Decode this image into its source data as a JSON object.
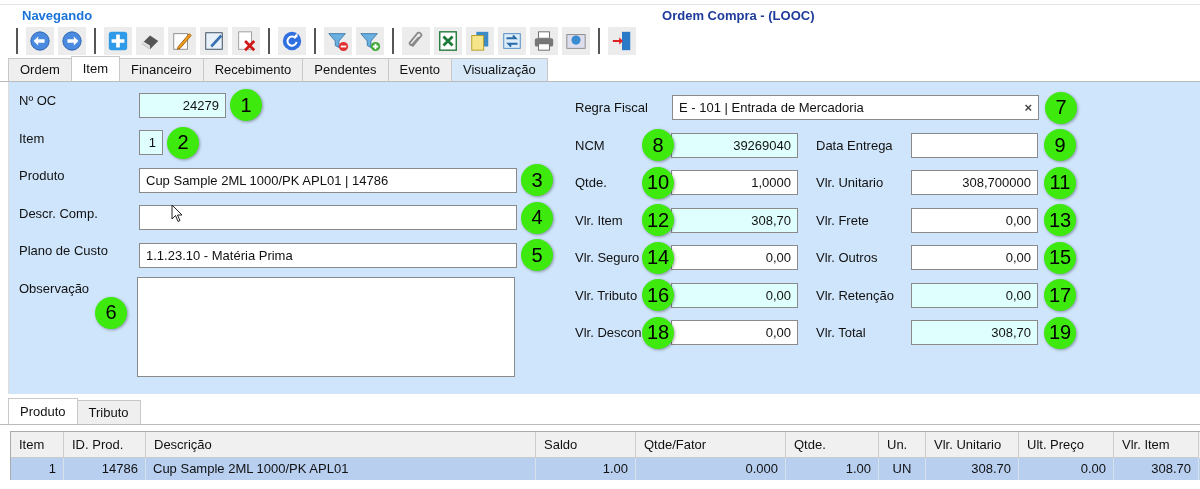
{
  "header": {
    "status": "Navegando",
    "title": "Ordem Compra - (LOOC)"
  },
  "tabs": [
    {
      "label": "Ordem",
      "selected": false,
      "hovered": false
    },
    {
      "label": "Item",
      "selected": true,
      "hovered": false
    },
    {
      "label": "Financeiro",
      "selected": false,
      "hovered": false
    },
    {
      "label": "Recebimento",
      "selected": false,
      "hovered": false
    },
    {
      "label": "Pendentes",
      "selected": false,
      "hovered": false
    },
    {
      "label": "Evento",
      "selected": false,
      "hovered": false
    },
    {
      "label": "Visualização",
      "selected": false,
      "hovered": true
    }
  ],
  "left_fields": [
    {
      "label": "Nº OC",
      "value": "24279",
      "readonly": true,
      "kind": "short",
      "marker": "1"
    },
    {
      "label": "Item",
      "value": "1",
      "readonly": true,
      "kind": "tiny",
      "marker": "2"
    },
    {
      "label": "Produto",
      "value": "Cup Sample 2ML 1000/PK APL01 | 14786",
      "readonly": false,
      "kind": "wide",
      "marker": "3"
    },
    {
      "label": "Descr. Comp.",
      "readonly": false,
      "kind": "wide",
      "marker": "4"
    },
    {
      "label": "Plano de Custo",
      "value": "1.1.23.10 - Matéria Prima",
      "readonly": false,
      "kind": "wide",
      "marker": "5"
    },
    {
      "label": "Observação",
      "readonly": false,
      "kind": "area",
      "marker": "6"
    }
  ],
  "regra_fiscal": {
    "label": "Regra Fiscal",
    "value": "E - 101 | Entrada de Mercadoria",
    "clear": "×",
    "marker": "7"
  },
  "right_fields": [
    {
      "label": "NCM",
      "value": "39269040",
      "readonly": true,
      "marker": "8"
    },
    {
      "label": "Data Entrega",
      "readonly": false,
      "marker": "9"
    },
    {
      "label": "Qtde.",
      "value": "1,0000",
      "readonly": false,
      "marker": "10"
    },
    {
      "label": "Vlr. Unitario",
      "value": "308,700000",
      "readonly": false,
      "marker": "11"
    },
    {
      "label": "Vlr. Item",
      "value": "308,70",
      "readonly": true,
      "marker": "12"
    },
    {
      "label": "Vlr. Frete",
      "value": "0,00",
      "readonly": false,
      "marker": "13"
    },
    {
      "label": "Vlr. Seguro",
      "value": "0,00",
      "readonly": false,
      "marker": "14"
    },
    {
      "label": "Vlr. Outros",
      "value": "0,00",
      "readonly": false,
      "marker": "15"
    },
    {
      "label": "Vlr. Tributo",
      "value": "0,00",
      "readonly": true,
      "marker": "16"
    },
    {
      "label": "Vlr. Retenção",
      "value": "0,00",
      "readonly": true,
      "marker": "17"
    },
    {
      "label": "Vlr. Descon",
      "value": "0,00",
      "readonly": false,
      "marker": "18"
    },
    {
      "label": "Vlr. Total",
      "value": "308,70",
      "readonly": true,
      "marker": "19"
    }
  ],
  "bottom_tabs": [
    {
      "label": "Produto",
      "selected": true
    },
    {
      "label": "Tributo",
      "selected": false
    }
  ],
  "table": {
    "columns": [
      {
        "label": "Item"
      },
      {
        "label": "ID. Prod."
      },
      {
        "label": "Descrição"
      },
      {
        "label": "Saldo"
      },
      {
        "label": "Qtde/Fator"
      },
      {
        "label": "Qtde."
      },
      {
        "label": "Un."
      },
      {
        "label": "Vlr. Unitario"
      },
      {
        "label": "Ult. Preço"
      },
      {
        "label": "Vlr. Item"
      }
    ],
    "rows": [
      {
        "selected": true,
        "cells": [
          "1",
          "14786",
          "Cup Sample 2ML 1000/PK APL01",
          "1.00",
          "0.000",
          "1.00",
          "UN",
          "308.70",
          "0.00",
          "308.70"
        ]
      }
    ]
  }
}
